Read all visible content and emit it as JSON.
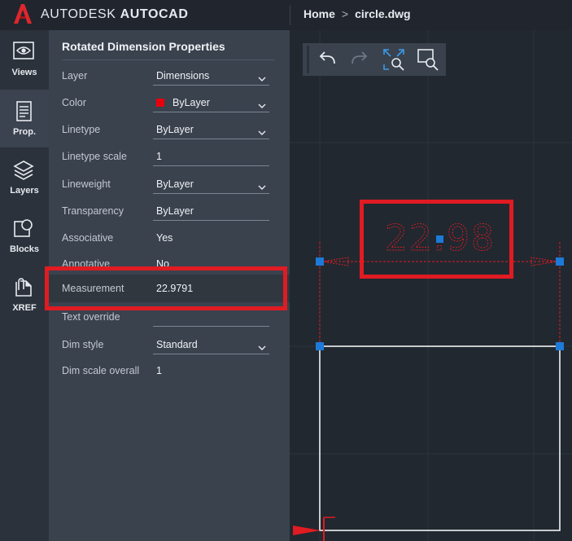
{
  "app": {
    "brand_light": "AUTODESK",
    "brand_bold": "AUTOCAD"
  },
  "breadcrumb": {
    "home": "Home",
    "separator": ">",
    "file": "circle.dwg"
  },
  "strip": {
    "views": "Views",
    "prop": "Prop.",
    "layers": "Layers",
    "blocks": "Blocks",
    "xref": "XREF"
  },
  "panel": {
    "title": "Rotated Dimension Properties",
    "rows": [
      {
        "label": "Layer",
        "value": "Dimensions"
      },
      {
        "label": "Color",
        "value": "ByLayer"
      },
      {
        "label": "Linetype",
        "value": "ByLayer"
      },
      {
        "label": "Linetype scale",
        "value": "1"
      },
      {
        "label": "Lineweight",
        "value": "ByLayer"
      },
      {
        "label": "Transparency",
        "value": "ByLayer"
      },
      {
        "label": "Associative",
        "value": "Yes"
      },
      {
        "label": "Annotative",
        "value": "No"
      },
      {
        "label": "Measurement",
        "value": "22.9791"
      },
      {
        "label": "Text override",
        "value": ""
      },
      {
        "label": "Dim style",
        "value": "Standard"
      },
      {
        "label": "Dim scale overall",
        "value": "1"
      }
    ]
  },
  "drawing": {
    "dimension_text": "22.98"
  },
  "colors": {
    "accent_red": "#e01b22",
    "grip_blue": "#1e7ad8",
    "layer_color": "#e8000b"
  }
}
